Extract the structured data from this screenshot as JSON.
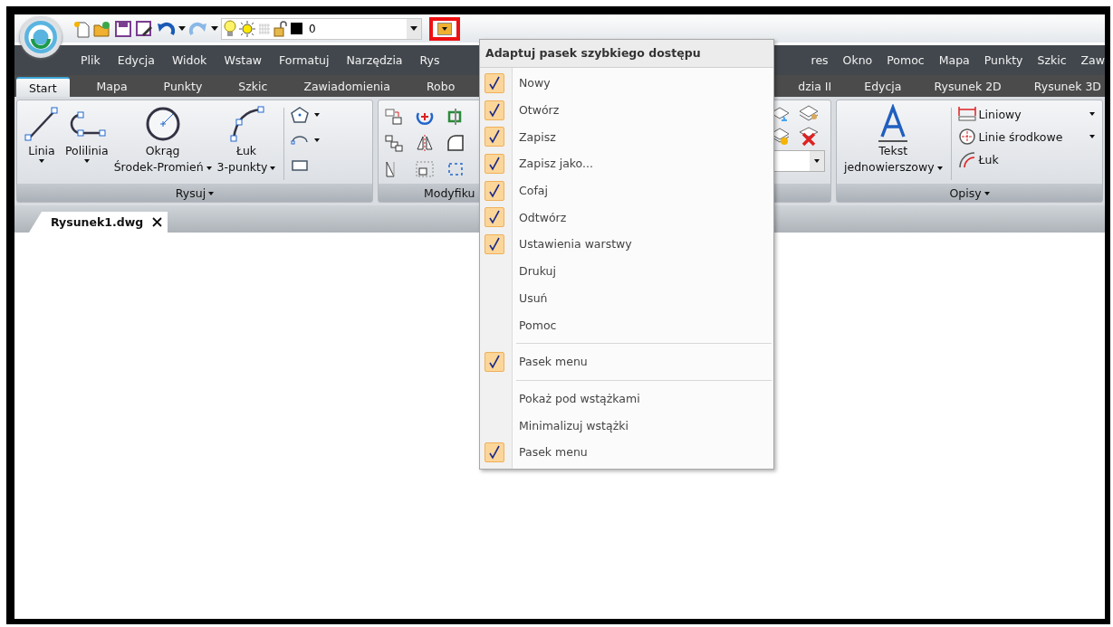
{
  "quick_access": {
    "layer_name": "0"
  },
  "menu_bar": {
    "left": [
      "Plik",
      "Edycja",
      "Widok",
      "Wstaw",
      "Formatuj",
      "Narzędzia",
      "Rys"
    ],
    "right": [
      "res",
      "Okno",
      "Pomoc",
      "Mapa",
      "Punkty",
      "Szkic",
      "Zaw"
    ]
  },
  "ribbon_tabs": {
    "left": [
      {
        "label": "Start",
        "selected": true
      },
      {
        "label": "Mapa",
        "selected": false
      },
      {
        "label": "Punkty",
        "selected": false
      },
      {
        "label": "Szkic",
        "selected": false
      },
      {
        "label": "Zawiadomienia",
        "selected": false
      },
      {
        "label": "Robo",
        "selected": false
      }
    ],
    "right": [
      {
        "label": "dzia II",
        "selected": false
      },
      {
        "label": "Edycja",
        "selected": false
      },
      {
        "label": "Rysunek 2D",
        "selected": false
      },
      {
        "label": "Rysunek 3D",
        "selected": false
      }
    ]
  },
  "draw_panel": {
    "title": "Rysuj",
    "tools": [
      {
        "kind": "line",
        "lines": [
          "Linia"
        ]
      },
      {
        "kind": "polyline",
        "lines": [
          "Polilinia"
        ]
      },
      {
        "kind": "circle",
        "lines": [
          "Okrąg",
          "Środek-Promień"
        ]
      },
      {
        "kind": "arc",
        "lines": [
          "Łuk",
          "3-punkty"
        ]
      }
    ]
  },
  "modify_panel": {
    "title": "Modyfiku"
  },
  "annotate_panel": {
    "title": "Opisy",
    "text_tool": [
      "Tekst",
      "jednowierszowy"
    ],
    "tools": [
      {
        "kind": "linear",
        "label": "Liniowy",
        "dropdown": true
      },
      {
        "kind": "centerline",
        "label": "Linie środkowe",
        "dropdown": true
      },
      {
        "kind": "arc",
        "label": "Łuk",
        "dropdown": false
      }
    ]
  },
  "document_tabs": [
    {
      "label": "Rysunek1.dwg"
    }
  ],
  "popup_menu": {
    "title": "Adaptuj pasek szybkiego dostępu",
    "items": [
      {
        "kind": "item",
        "label": "Nowy",
        "checked": true
      },
      {
        "kind": "item",
        "label": "Otwórz",
        "checked": true
      },
      {
        "kind": "item",
        "label": "Zapisz",
        "checked": true
      },
      {
        "kind": "item",
        "label": "Zapisz jako...",
        "checked": true
      },
      {
        "kind": "item",
        "label": "Cofaj",
        "checked": true
      },
      {
        "kind": "item",
        "label": "Odtwórz",
        "checked": true
      },
      {
        "kind": "item",
        "label": "Ustawienia warstwy",
        "checked": true
      },
      {
        "kind": "item",
        "label": "Drukuj",
        "checked": false
      },
      {
        "kind": "item",
        "label": "Usuń",
        "checked": false
      },
      {
        "kind": "item",
        "label": "Pomoc",
        "checked": false
      },
      {
        "kind": "separator"
      },
      {
        "kind": "item",
        "label": "Pasek menu",
        "checked": true
      },
      {
        "kind": "separator"
      },
      {
        "kind": "item",
        "label": "Pokaż pod wstążkami",
        "checked": false
      },
      {
        "kind": "item",
        "label": "Minimalizuj wstążki",
        "checked": false
      },
      {
        "kind": "item",
        "label": "Pasek menu",
        "checked": true
      }
    ]
  }
}
